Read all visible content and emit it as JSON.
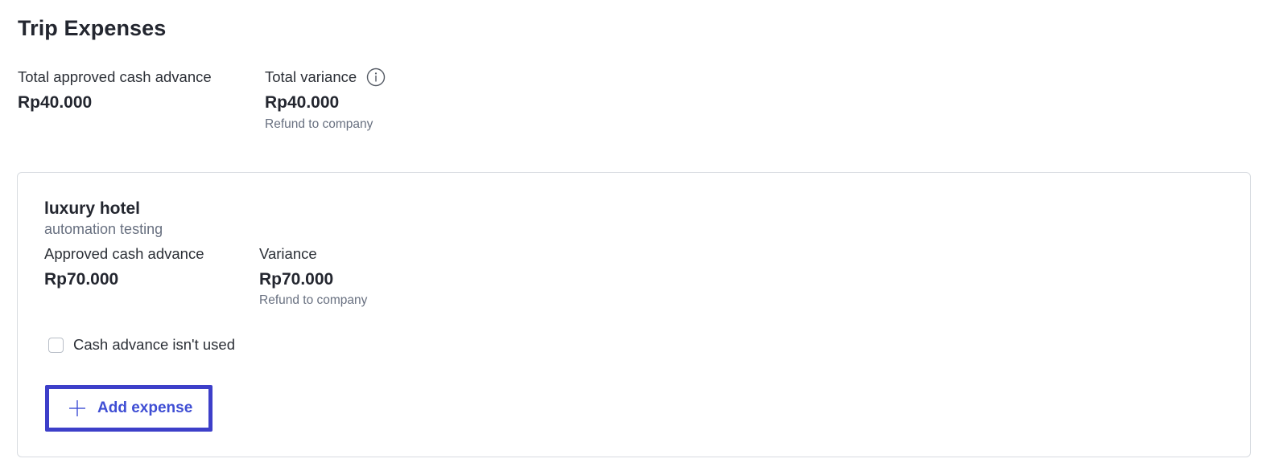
{
  "page": {
    "title": "Trip Expenses"
  },
  "summary": {
    "approved_label": "Total approved cash advance",
    "approved_value": "Rp40.000",
    "variance_label": "Total variance",
    "variance_value": "Rp40.000",
    "variance_note": "Refund to company",
    "info_icon": "info-circle-icon"
  },
  "card": {
    "title": "luxury hotel",
    "subtitle": "automation testing",
    "approved_label": "Approved cash advance",
    "approved_value": "Rp70.000",
    "variance_label": "Variance",
    "variance_value": "Rp70.000",
    "variance_note": "Refund to company",
    "checkbox_label": "Cash advance isn't used",
    "checkbox_checked": false,
    "add_button_label": "Add expense",
    "add_button_icon": "plus-icon"
  },
  "colors": {
    "accent": "#3f4ed4",
    "focus_border": "#3d3fc9",
    "muted_text": "#687080",
    "card_border": "#d7dbe0"
  }
}
